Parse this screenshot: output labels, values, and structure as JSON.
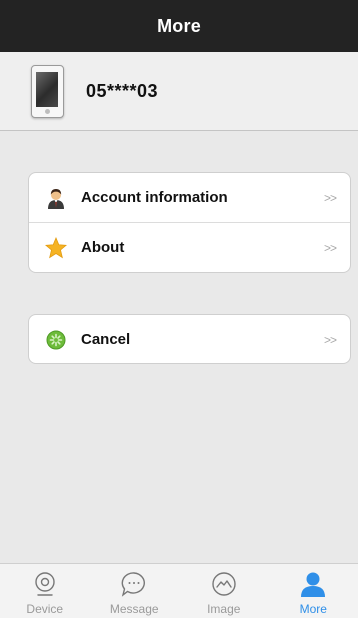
{
  "header": {
    "title": "More"
  },
  "profile": {
    "device_id": "05****03",
    "icon": "phone-icon"
  },
  "menu": {
    "group1": [
      {
        "label": "Account information",
        "icon": "user-avatar-icon",
        "arrow": ">>"
      },
      {
        "label": "About",
        "icon": "star-icon",
        "arrow": ">>"
      }
    ],
    "group2": [
      {
        "label": "Cancel",
        "icon": "cancel-green-icon",
        "arrow": ">>"
      }
    ]
  },
  "tabbar": {
    "tabs": [
      {
        "label": "Device",
        "icon": "camera-icon",
        "active": false
      },
      {
        "label": "Message",
        "icon": "chat-bubble-icon",
        "active": false
      },
      {
        "label": "Image",
        "icon": "image-icon",
        "active": false
      },
      {
        "label": "More",
        "icon": "person-icon",
        "active": true
      }
    ]
  },
  "colors": {
    "header_bg": "#232323",
    "accent": "#2f8fe8",
    "page_bg": "#e9e9e9"
  }
}
